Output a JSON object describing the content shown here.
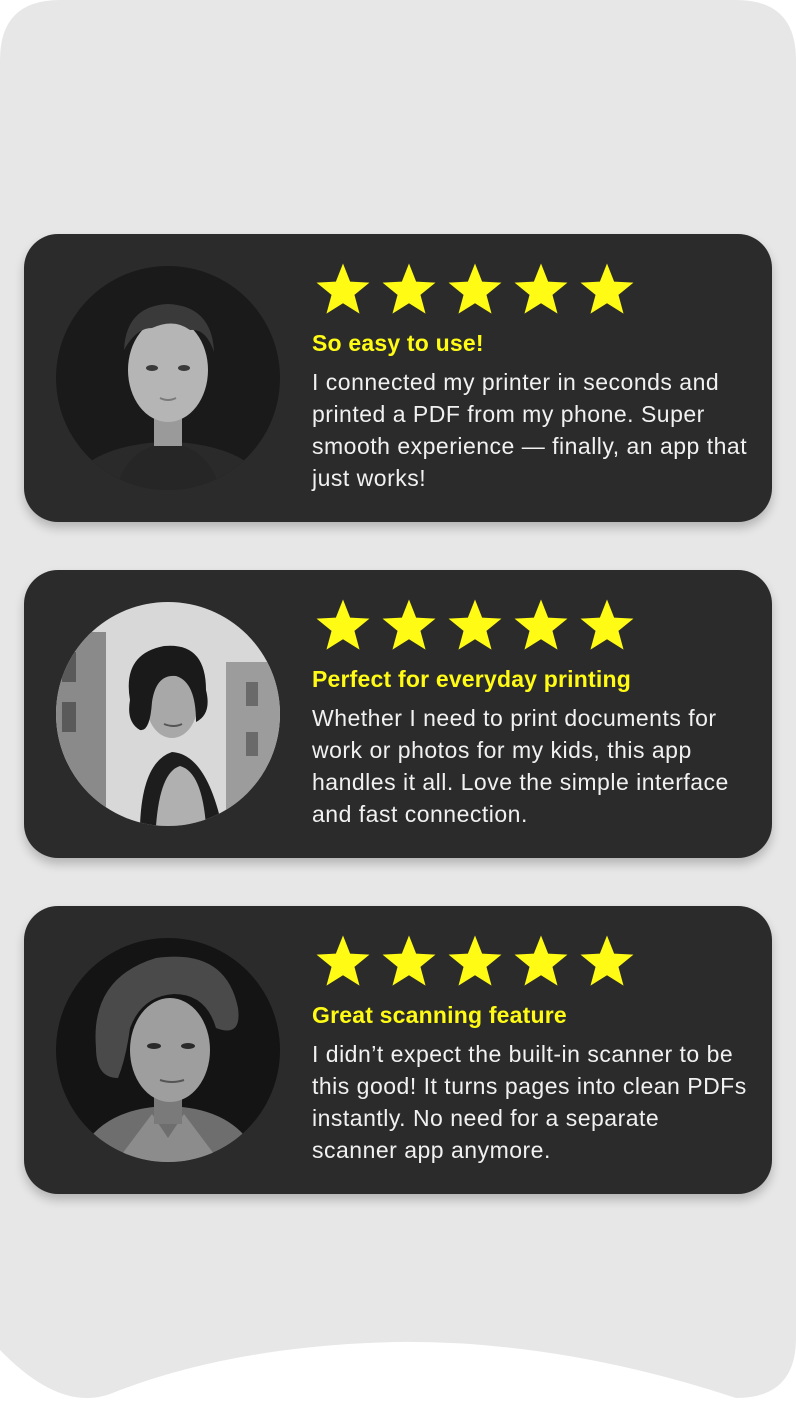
{
  "colors": {
    "page_background": "#e7e7e7",
    "card_background": "#2b2b2b",
    "star": "#fffb15",
    "title": "#fffb15",
    "body_text": "#f1f1f1"
  },
  "reviews": [
    {
      "rating": 5,
      "avatar": "grayscale portrait of short-haired woman",
      "title": "So easy to use!",
      "text": "I connected my printer in seconds and printed a PDF from my phone. Super smooth experience — finally, an app that just works!"
    },
    {
      "rating": 5,
      "avatar": "grayscale portrait of curly-haired woman on street",
      "title": "Perfect for everyday printing",
      "text": "Whether I need to print documents for work or photos for my kids, this app handles it all. Love the simple interface and fast connection."
    },
    {
      "rating": 5,
      "avatar": "grayscale portrait of woman with windswept hair",
      "title": "Great scanning feature",
      "text": "I didn’t expect the built-in scanner to be this good! It turns pages into clean PDFs instantly. No need for a separate scanner app anymore."
    }
  ]
}
